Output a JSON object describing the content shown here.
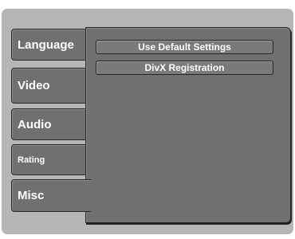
{
  "tabs": [
    {
      "label": "Language",
      "selected": false
    },
    {
      "label": "Video",
      "selected": false
    },
    {
      "label": "Audio",
      "selected": false
    },
    {
      "label": "Rating",
      "selected": false
    },
    {
      "label": "Misc",
      "selected": true
    }
  ],
  "panel": {
    "items": [
      {
        "label": "Use Default Settings"
      },
      {
        "label": "DivX Registration"
      }
    ]
  },
  "colors": {
    "frame": "#b6b6b6",
    "panel": "#707070",
    "text": "#ffffff",
    "border": "#2a2a2a"
  }
}
